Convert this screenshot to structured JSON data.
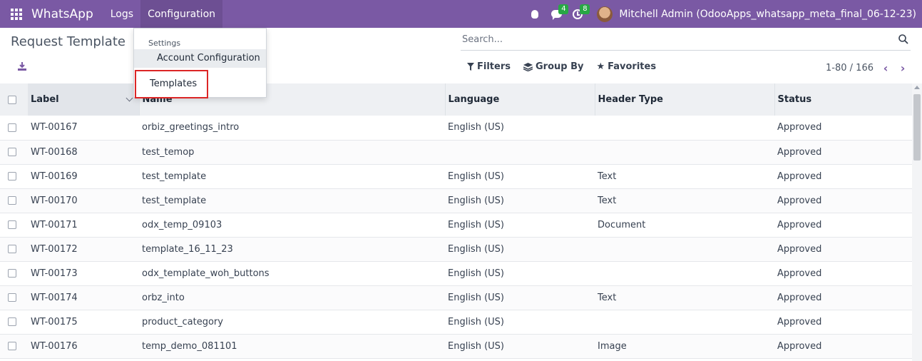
{
  "navbar": {
    "app_name": "WhatsApp",
    "menu": [
      "Logs",
      "Configuration"
    ],
    "icons": [
      "apps-grid-icon",
      "bug-icon",
      "chat-icon",
      "clock-icon"
    ],
    "messages_badge": "4",
    "activities_badge": "8",
    "user": "Mitchell Admin (OdooApps_whatsapp_meta_final_06-12-23)",
    "color": "#7a59a4"
  },
  "control_panel": {
    "title": "Request Template",
    "search_placeholder": "Search...",
    "filters_label": "Filters",
    "group_by_label": "Group By",
    "favorites_label": "Favorites",
    "pager_value": "1-80 / 166"
  },
  "dropdown": {
    "section_header": "Settings",
    "items": [
      "Account Configuration",
      "Templates"
    ],
    "highlighted_item": "Templates"
  },
  "table": {
    "columns": [
      "Label",
      "Name",
      "Language",
      "Header Type",
      "Status"
    ],
    "rows": [
      {
        "label": "WT-00167",
        "name": "orbiz_greetings_intro",
        "language": "English (US)",
        "header_type": "",
        "status": "Approved"
      },
      {
        "label": "WT-00168",
        "name": "test_temop",
        "language": "",
        "header_type": "",
        "status": "Approved"
      },
      {
        "label": "WT-00169",
        "name": "test_template",
        "language": "English (US)",
        "header_type": "Text",
        "status": "Approved"
      },
      {
        "label": "WT-00170",
        "name": "test_template",
        "language": "English (US)",
        "header_type": "Text",
        "status": "Approved"
      },
      {
        "label": "WT-00171",
        "name": "odx_temp_09103",
        "language": "English (US)",
        "header_type": "Document",
        "status": "Approved"
      },
      {
        "label": "WT-00172",
        "name": "template_16_11_23",
        "language": "English (US)",
        "header_type": "",
        "status": "Approved"
      },
      {
        "label": "WT-00173",
        "name": "odx_template_woh_buttons",
        "language": "English (US)",
        "header_type": "",
        "status": "Approved"
      },
      {
        "label": "WT-00174",
        "name": "orbz_into",
        "language": "English (US)",
        "header_type": "Text",
        "status": "Approved"
      },
      {
        "label": "WT-00175",
        "name": "product_category",
        "language": "English (US)",
        "header_type": "",
        "status": "Approved"
      },
      {
        "label": "WT-00176",
        "name": "temp_demo_081101",
        "language": "English (US)",
        "header_type": "Image",
        "status": "Approved"
      }
    ]
  }
}
